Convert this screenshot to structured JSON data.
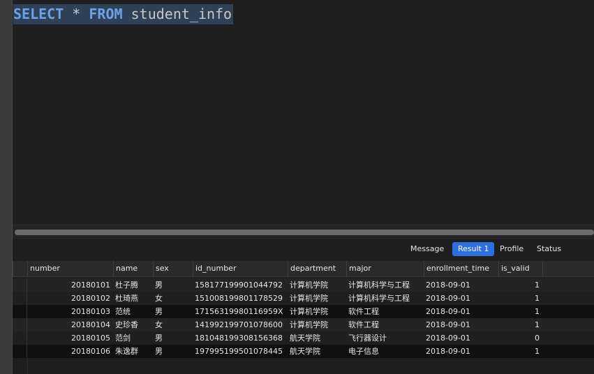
{
  "editor": {
    "query_tokens": {
      "kw1": "SELECT",
      "star": "*",
      "kw2": "FROM",
      "table": "student_info"
    }
  },
  "result_tabs": [
    {
      "label": "Message",
      "active": false
    },
    {
      "label": "Result 1",
      "active": true
    },
    {
      "label": "Profile",
      "active": false
    },
    {
      "label": "Status",
      "active": false
    }
  ],
  "table": {
    "columns": [
      "number",
      "name",
      "sex",
      "id_number",
      "department",
      "major",
      "enrollment_time",
      "is_valid"
    ],
    "rows": [
      [
        "20180101",
        "杜子腾",
        "男",
        "158177199901044792",
        "计算机学院",
        "计算机科学与工程",
        "2018-09-01",
        "1"
      ],
      [
        "20180102",
        "杜琦燕",
        "女",
        "151008199801178529",
        "计算机学院",
        "计算机科学与工程",
        "2018-09-01",
        "1"
      ],
      [
        "20180103",
        "范统",
        "男",
        "17156319980116959X",
        "计算机学院",
        "软件工程",
        "2018-09-01",
        "1"
      ],
      [
        "20180104",
        "史珍香",
        "女",
        "141992199701078600",
        "计算机学院",
        "软件工程",
        "2018-09-01",
        "1"
      ],
      [
        "20180105",
        "范剑",
        "男",
        "181048199308156368",
        "航天学院",
        "飞行器设计",
        "2018-09-01",
        "0"
      ],
      [
        "20180106",
        "朱逸群",
        "男",
        "197995199501078445",
        "航天学院",
        "电子信息",
        "2018-09-01",
        "1"
      ]
    ]
  },
  "colors": {
    "keyword": "#6ea2e6",
    "active_tab": "#2b6fe0",
    "selection": "#2f4157"
  }
}
